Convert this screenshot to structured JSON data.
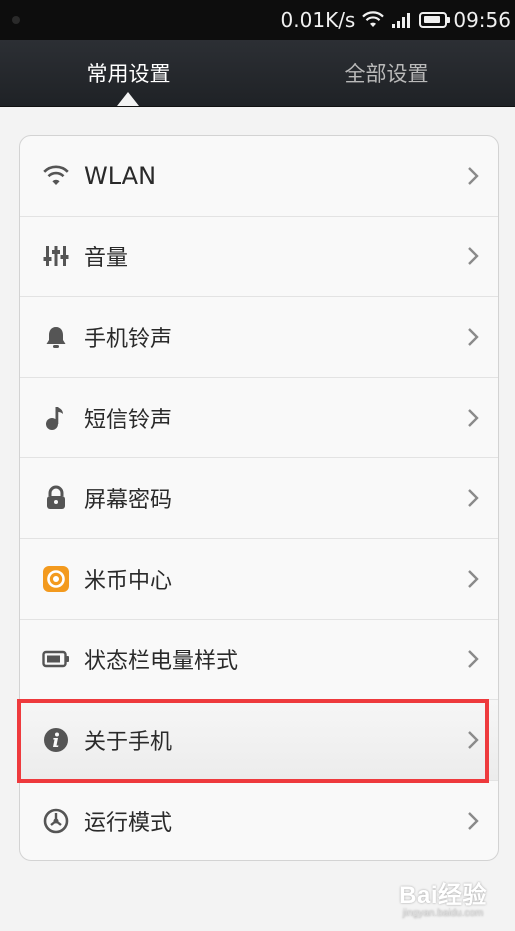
{
  "status_bar": {
    "speed": "0.01K/s",
    "time": "09:56",
    "icons": [
      "wifi-icon",
      "signal-icon",
      "battery-icon"
    ]
  },
  "tabs": [
    {
      "label": "常用设置",
      "selected": true
    },
    {
      "label": "全部设置",
      "selected": false
    }
  ],
  "settings": {
    "items": [
      {
        "label": "WLAN",
        "icon": "wifi-icon"
      },
      {
        "label": "音量",
        "icon": "volume-sliders-icon"
      },
      {
        "label": "手机铃声",
        "icon": "bell-icon"
      },
      {
        "label": "短信铃声",
        "icon": "music-note-icon"
      },
      {
        "label": "屏幕密码",
        "icon": "lock-icon"
      },
      {
        "label": "米币中心",
        "icon": "mi-coin-icon"
      },
      {
        "label": "状态栏电量样式",
        "icon": "battery-style-icon"
      },
      {
        "label": "关于手机",
        "icon": "info-icon",
        "highlighted": true
      },
      {
        "label": "运行模式",
        "icon": "speedometer-icon"
      }
    ]
  },
  "annotation": {
    "color": "#ee3a3d"
  },
  "watermark": {
    "main": "Bai经验",
    "sub": "jingyan.baidu.com"
  }
}
